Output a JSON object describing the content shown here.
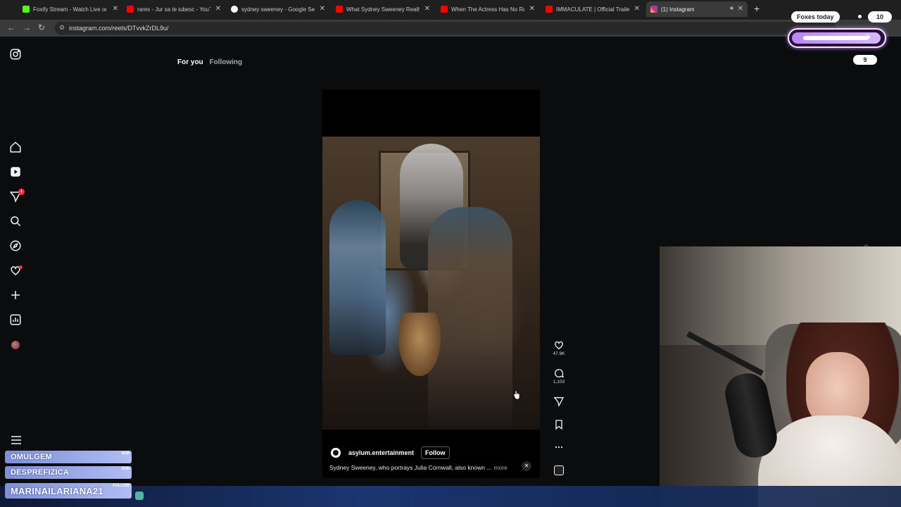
{
  "browser": {
    "tabs": [
      {
        "title": "Foxify Stream - Watch Live on K",
        "favicon_color": "#53fc18"
      },
      {
        "title": "rares - Jur sa te iubesc - YouTub",
        "favicon_color": "#ff0000"
      },
      {
        "title": "sydney sweeney - Google Search",
        "favicon_color": "#ffffff"
      },
      {
        "title": "What Sydney Sweeney Really E",
        "favicon_color": "#ff0000"
      },
      {
        "title": "When The Actress Has No Rang",
        "favicon_color": "#ff0000"
      },
      {
        "title": "IMMACULATE | Official Trailer |",
        "favicon_color": "#ff0000"
      },
      {
        "title": "(1) Instagram",
        "favicon_color": "#d62976"
      }
    ],
    "url": "instagram.com/reels/DTvvkZrDL9u/"
  },
  "instagram": {
    "tabs": {
      "for_you": "For you",
      "following": "Following"
    },
    "notification_badge": "1",
    "reel": {
      "username": "asylum.entertainment",
      "follow_label": "Follow",
      "caption": "Sydney Sweeney, who portrays Julia Cornwall, also known ...",
      "more_label": "more"
    },
    "actions": {
      "likes": "47.9K",
      "comments": "1,103"
    }
  },
  "overlay": {
    "foxes_label": "Foxes today",
    "foxes_count": "10",
    "level": "9",
    "chat": [
      {
        "name": "OMULGEM",
        "tag": "SUB"
      },
      {
        "name": "DESPREFIZICA",
        "tag": "SUB"
      },
      {
        "name": "MARINAILARIANA21",
        "tag": "FOLLOW"
      }
    ]
  },
  "colors": {
    "accent_purple": "#b787f5",
    "chat_blue": "#7e8fd8",
    "instagram_bg": "#0b0c0e",
    "badge_red": "#ff3040"
  }
}
